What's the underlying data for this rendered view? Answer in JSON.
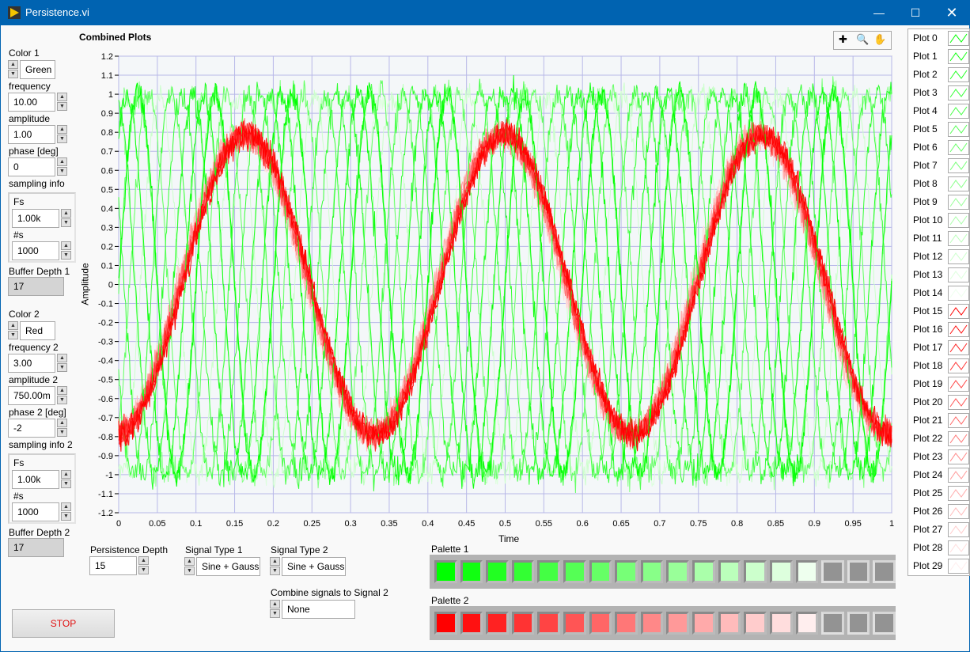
{
  "window": {
    "title": "Persistence.vi",
    "icon": "labview-vi-icon",
    "controls": [
      "minimize-icon",
      "maximize-icon",
      "close-icon"
    ]
  },
  "left": {
    "color1": {
      "label": "Color 1",
      "value": "Green"
    },
    "frequency": {
      "label": "frequency",
      "value": "10.00"
    },
    "amplitude": {
      "label": "amplitude",
      "value": "1.00"
    },
    "phase": {
      "label": "phase [deg]",
      "value": "0"
    },
    "sampling": {
      "label": "sampling info",
      "fs_label": "Fs",
      "fs": "1.00k",
      "ns_label": "#s",
      "ns": "1000"
    },
    "buffer1": {
      "label": "Buffer Depth 1",
      "value": "17"
    },
    "color2": {
      "label": "Color 2",
      "value": "Red"
    },
    "frequency2": {
      "label": "frequency 2",
      "value": "3.00"
    },
    "amplitude2": {
      "label": "amplitude 2",
      "value": "750.00m"
    },
    "phase2": {
      "label": "phase 2 [deg]",
      "value": "-2"
    },
    "sampling2": {
      "label": "sampling info 2",
      "fs_label": "Fs",
      "fs": "1.00k",
      "ns_label": "#s",
      "ns": "1000"
    },
    "buffer2": {
      "label": "Buffer Depth 2",
      "value": "17"
    },
    "stop": "STOP"
  },
  "bottom": {
    "persistence": {
      "label": "Persistence Depth",
      "value": "15"
    },
    "signal1": {
      "label": "Signal Type 1",
      "value": "Sine + Gauss"
    },
    "signal2": {
      "label": "Signal Type 2",
      "value": "Sine + Gauss"
    },
    "combine": {
      "label": "Combine signals to Signal 2",
      "value": "None"
    },
    "palette1": {
      "label": "Palette 1",
      "colors": [
        "#00ff00",
        "#11ff11",
        "#22ff22",
        "#33ff33",
        "#44ff44",
        "#55ff55",
        "#66ff66",
        "#77ff77",
        "#88ff88",
        "#99ff99",
        "#aaffaa",
        "#bbffbb",
        "#ccffcc",
        "#ddffdd",
        "#eeffee"
      ],
      "empty": 3
    },
    "palette2": {
      "label": "Palette 2",
      "colors": [
        "#ff0000",
        "#ff1111",
        "#ff2222",
        "#ff3333",
        "#ff4444",
        "#ff5555",
        "#ff6666",
        "#ff7777",
        "#ff8888",
        "#ff9999",
        "#ffaaaa",
        "#ffbbbb",
        "#ffcccc",
        "#ffdddd",
        "#ffeeee"
      ],
      "empty": 3
    }
  },
  "chart_data": {
    "type": "line",
    "title": "Combined Plots",
    "xlabel": "Time",
    "ylabel": "Amplitude",
    "xlim": [
      0,
      1
    ],
    "ylim": [
      -1.2,
      1.2
    ],
    "grid": true,
    "legend": "right",
    "xticks": [
      "0",
      "0.05",
      "0.1",
      "0.15",
      "0.2",
      "0.25",
      "0.3",
      "0.35",
      "0.4",
      "0.45",
      "0.5",
      "0.55",
      "0.6",
      "0.65",
      "0.7",
      "0.75",
      "0.8",
      "0.85",
      "0.9",
      "0.95",
      "1"
    ],
    "yticks": [
      "1.2",
      "1.1",
      "1",
      "0.9",
      "0.8",
      "0.7",
      "0.6",
      "0.5",
      "0.4",
      "0.3",
      "0.2",
      "0.1",
      "0",
      "-0.1",
      "-0.2",
      "-0.3",
      "-0.4",
      "-0.5",
      "-0.6",
      "-0.7",
      "-0.8",
      "-0.9",
      "-1",
      "-1.1",
      "-1.2"
    ],
    "signal1": {
      "type": "Sine + Gauss",
      "frequency": 10,
      "amplitude": 1,
      "phase_deg": 0,
      "color": "#00ff00"
    },
    "signal2": {
      "type": "Sine + Gauss",
      "frequency": 3,
      "amplitude": 0.75,
      "phase_deg": -2,
      "color": "#ff0000"
    },
    "legend_entries": [
      "Plot 0",
      "Plot 1",
      "Plot 2",
      "Plot 3",
      "Plot 4",
      "Plot 5",
      "Plot 6",
      "Plot 7",
      "Plot 8",
      "Plot 9",
      "Plot 10",
      "Plot 11",
      "Plot 12",
      "Plot 13",
      "Plot 14",
      "Plot 15",
      "Plot 16",
      "Plot 17",
      "Plot 18",
      "Plot 19",
      "Plot 20",
      "Plot 21",
      "Plot 22",
      "Plot 23",
      "Plot 24",
      "Plot 25",
      "Plot 26",
      "Plot 27",
      "Plot 28",
      "Plot 29"
    ],
    "tools": [
      "cursor-icon",
      "zoom-icon",
      "pan-hand-icon"
    ]
  }
}
